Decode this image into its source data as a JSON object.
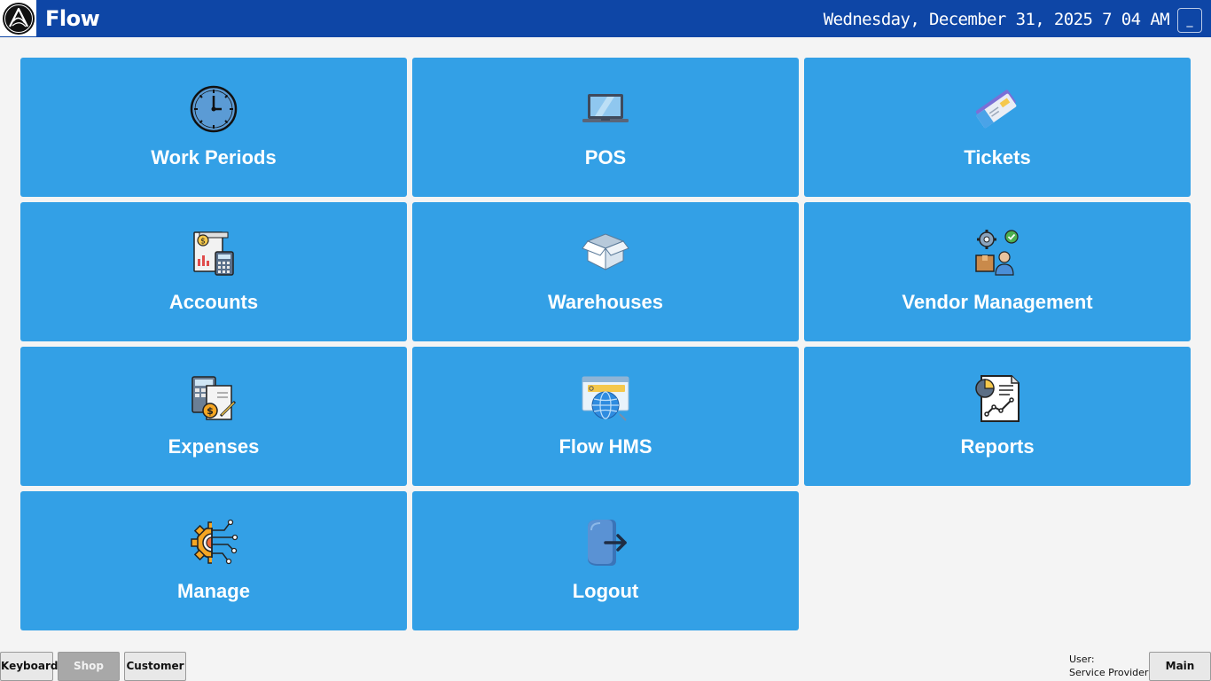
{
  "header": {
    "app_title": "Flow",
    "datetime": "Wednesday, December 31, 2025 7 04 AM",
    "minimize_label": "_",
    "color": "#0e46a6"
  },
  "tiles": [
    {
      "label": "Work Periods",
      "icon": "clock-icon"
    },
    {
      "label": "POS",
      "icon": "laptop-icon"
    },
    {
      "label": "Tickets",
      "icon": "tickets-icon"
    },
    {
      "label": "Accounts",
      "icon": "accounts-calculator-icon"
    },
    {
      "label": "Warehouses",
      "icon": "open-box-icon"
    },
    {
      "label": "Vendor Management",
      "icon": "vendor-gear-person-icon"
    },
    {
      "label": "Expenses",
      "icon": "expenses-calculator-icon"
    },
    {
      "label": "Flow HMS",
      "icon": "web-globe-icon"
    },
    {
      "label": "Reports",
      "icon": "report-chart-icon"
    },
    {
      "label": "Manage",
      "icon": "gear-circuit-icon"
    },
    {
      "label": "Logout",
      "icon": "logout-arrow-icon"
    }
  ],
  "tile_color": "#33a0e6",
  "footer": {
    "keyboard_label": "Keyboard",
    "shop_label": "Shop",
    "customer_label": "Customer",
    "user_label": "User:",
    "user_value": "Service Provider",
    "main_menu_label": "Main Menu"
  }
}
